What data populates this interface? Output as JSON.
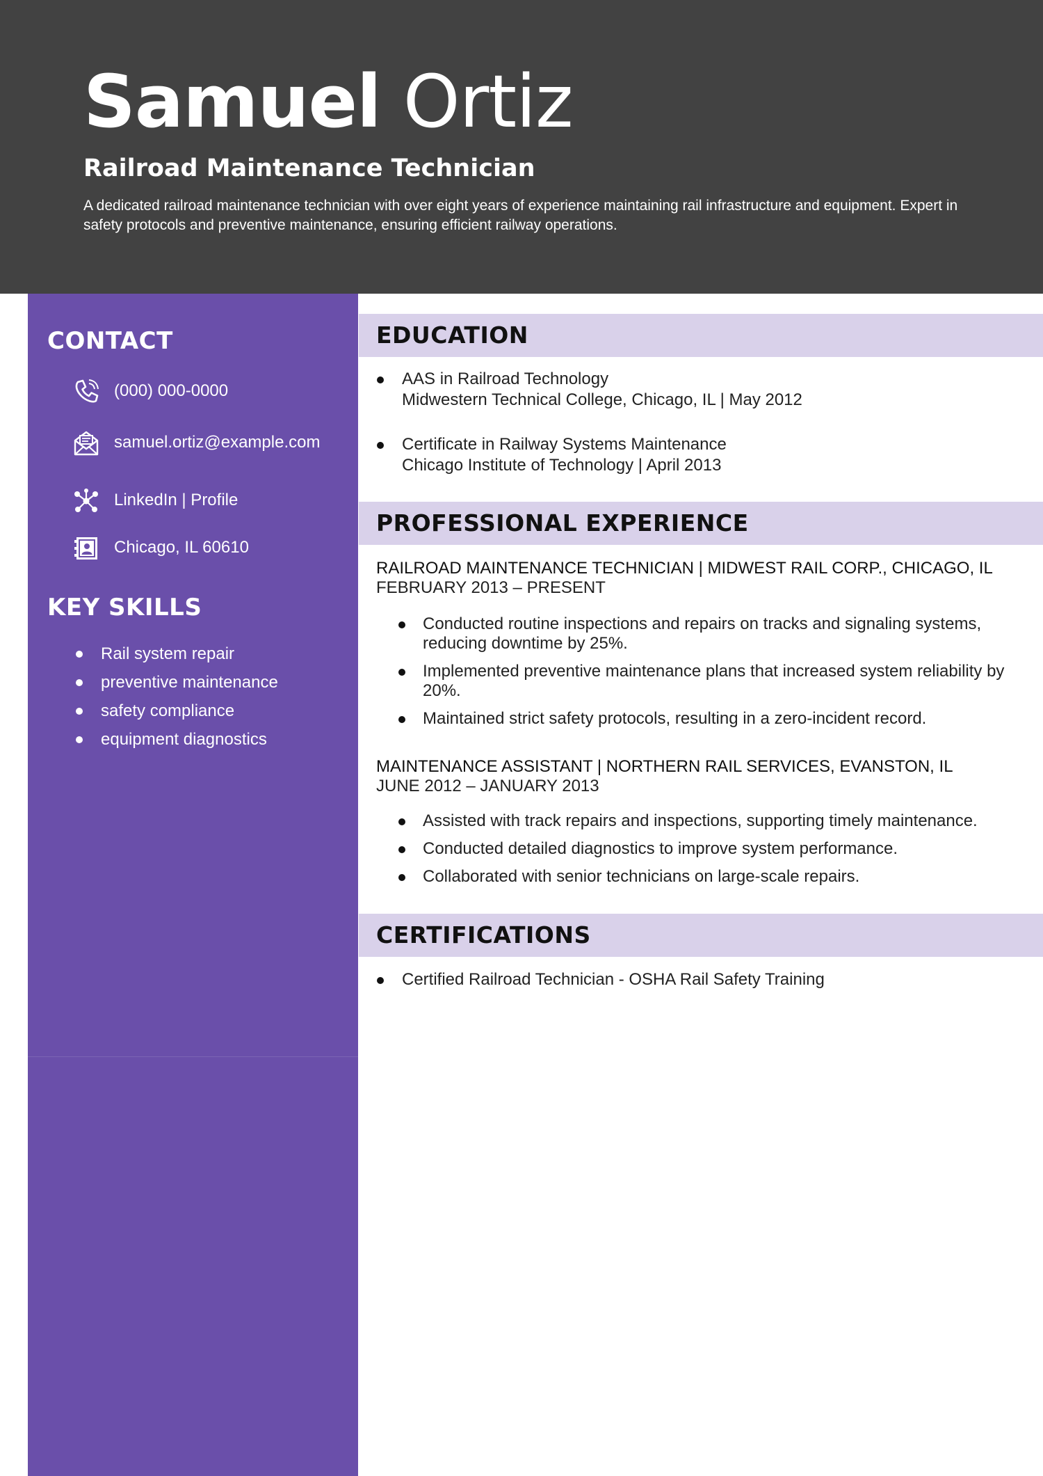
{
  "header": {
    "first_name": "Samuel",
    "last_name": "Ortiz",
    "job_title": "Railroad Maintenance Technician",
    "summary": "A dedicated railroad maintenance technician with over eight years of experience maintaining rail infrastructure and equipment. Expert in safety protocols and preventive maintenance, ensuring efficient railway operations."
  },
  "sidebar": {
    "contact_heading": "CONTACT",
    "contacts": [
      {
        "icon": "phone-icon",
        "text": "(000) 000-0000"
      },
      {
        "icon": "email-icon",
        "text": "samuel.ortiz@example.com"
      },
      {
        "icon": "network-icon",
        "text": "LinkedIn | Profile"
      },
      {
        "icon": "address-card-icon",
        "text": "Chicago, IL 60610"
      }
    ],
    "skills_heading": "KEY SKILLS",
    "skills": [
      "Rail system repair",
      "preventive maintenance",
      "safety compliance",
      "equipment diagnostics"
    ]
  },
  "education": {
    "heading": "EDUCATION",
    "items": [
      {
        "degree": "AAS in Railroad Technology",
        "detail": "Midwestern Technical College, Chicago, IL | May 2012"
      },
      {
        "degree": "Certificate in Railway Systems Maintenance",
        "detail": "Chicago Institute of Technology | April 2013"
      }
    ]
  },
  "experience": {
    "heading": "PROFESSIONAL EXPERIENCE",
    "jobs": [
      {
        "title_line": "RAILROAD MAINTENANCE TECHNICIAN | MIDWEST RAIL CORP., CHICAGO, IL",
        "dates": "FEBRUARY 2013 – PRESENT",
        "bullets": [
          "Conducted routine inspections and repairs on tracks and signaling systems, reducing downtime by 25%.",
          "Implemented preventive maintenance plans that increased system reliability by 20%.",
          "Maintained strict safety protocols, resulting in a zero-incident record."
        ]
      },
      {
        "title_line": "MAINTENANCE ASSISTANT | NORTHERN RAIL SERVICES, EVANSTON, IL",
        "dates": "JUNE 2012 – JANUARY 2013",
        "bullets": [
          "Assisted with track repairs and inspections, supporting timely maintenance.",
          "Conducted detailed diagnostics to improve system performance.",
          "Collaborated with senior technicians on large-scale repairs."
        ]
      }
    ]
  },
  "certifications": {
    "heading": "CERTIFICATIONS",
    "items": [
      "Certified Railroad Technician - OSHA Rail Safety Training"
    ]
  },
  "colors": {
    "header_bg": "#424242",
    "sidebar_bg": "#6a4faa",
    "section_bar_bg": "#d9d1ea"
  }
}
